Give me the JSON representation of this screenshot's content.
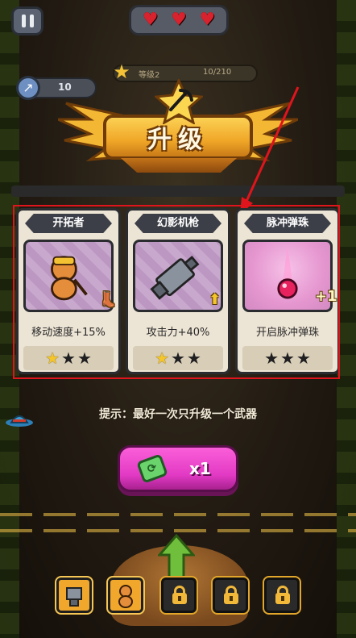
{
  "hud": {
    "hearts": [
      "♥",
      "♥",
      "♥"
    ],
    "level_label": "等级2",
    "level_progress": "10/210",
    "score_value": "10"
  },
  "banner": {
    "title": "升级"
  },
  "cards": [
    {
      "name": "开拓者",
      "description": "移动速度+15%",
      "stars": {
        "filled": 1,
        "total": 3
      },
      "art": "character-pioneer",
      "badge_icon": "boot-icon"
    },
    {
      "name": "幻影机枪",
      "description": "攻击力+40%",
      "stars": {
        "filled": 1,
        "total": 3
      },
      "art": "phantom-gun",
      "badge_icon": "upgrade-arrow-icon"
    },
    {
      "name": "脉冲弹珠",
      "description": "开启脉冲弹珠",
      "stars": {
        "filled": 0,
        "total": 3
      },
      "art": "pulse-marble",
      "badge_text": "+1"
    }
  ],
  "hint": "提示：最好一次只升级一个武器",
  "refresh": {
    "count_label": "x1",
    "icon": "refresh-ticket-icon"
  },
  "inventory": {
    "slots": [
      {
        "state": "filled",
        "icon": "gun-icon"
      },
      {
        "state": "filled",
        "icon": "pioneer-icon"
      },
      {
        "state": "locked",
        "icon": "lock-icon"
      },
      {
        "state": "locked",
        "icon": "lock-icon"
      },
      {
        "state": "locked",
        "icon": "lock-icon"
      }
    ]
  },
  "colors": {
    "highlight_frame": "#e0141c",
    "star_filled": "#f5c62a",
    "star_empty": "#1f1f22",
    "refresh_button": "#e23ac4",
    "banner_gold": "#f0a627"
  }
}
